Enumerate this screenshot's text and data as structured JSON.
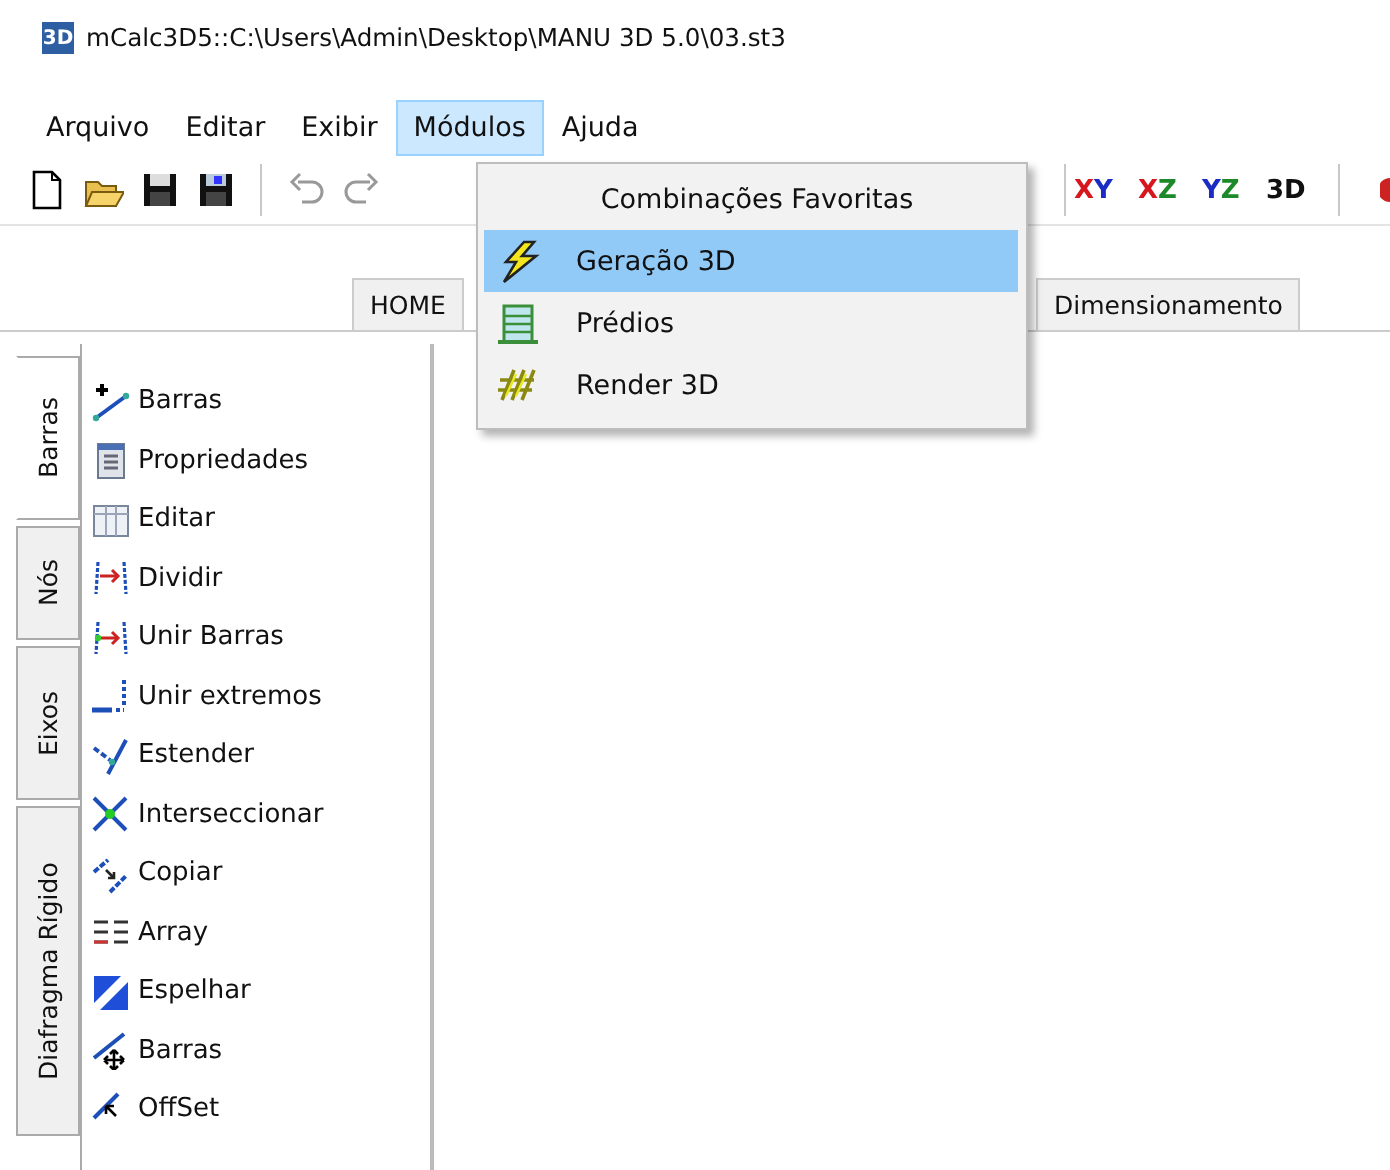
{
  "window": {
    "icon_text": "3D",
    "title": "mCalc3D5::C:\\Users\\Admin\\Desktop\\MANU 3D 5.0\\03.st3"
  },
  "menu_bar": [
    {
      "label": "Arquivo",
      "selected": false
    },
    {
      "label": "Editar",
      "selected": false
    },
    {
      "label": "Exibir",
      "selected": false
    },
    {
      "label": "Módulos",
      "selected": true
    },
    {
      "label": "Ajuda",
      "selected": false
    }
  ],
  "toolbar": {
    "view_buttons": [
      {
        "parts": [
          {
            "text": "X",
            "color": "#d8161e"
          },
          {
            "text": "Y",
            "color": "#1a2cc4"
          }
        ]
      },
      {
        "parts": [
          {
            "text": "X",
            "color": "#d8161e"
          },
          {
            "text": "Z",
            "color": "#1d8a2a"
          }
        ]
      },
      {
        "parts": [
          {
            "text": "Y",
            "color": "#1a2cc4"
          },
          {
            "text": "Z",
            "color": "#1d8a2a"
          }
        ]
      },
      {
        "parts": [
          {
            "text": "3D",
            "color": "#111111"
          }
        ]
      }
    ]
  },
  "tabs": [
    {
      "label": "HOME"
    },
    {
      "label": "Dimensionamento"
    }
  ],
  "side_tabs": [
    {
      "label": "Barras",
      "selected": true
    },
    {
      "label": "Nós",
      "selected": false
    },
    {
      "label": "Eixos",
      "selected": false
    },
    {
      "label": "Diafragma Rígido",
      "selected": false
    }
  ],
  "tools": [
    {
      "label": "Barras",
      "kind": "add-bar"
    },
    {
      "label": "Propriedades",
      "kind": "properties"
    },
    {
      "label": "Editar",
      "kind": "edit"
    },
    {
      "label": "Dividir",
      "kind": "divide"
    },
    {
      "label": "Unir Barras",
      "kind": "join"
    },
    {
      "label": "Unir extremos",
      "kind": "join-ends"
    },
    {
      "label": "Estender",
      "kind": "extend"
    },
    {
      "label": "Interseccionar",
      "kind": "intersect"
    },
    {
      "label": "Copiar",
      "kind": "copy"
    },
    {
      "label": "Array",
      "kind": "array"
    },
    {
      "label": "Espelhar",
      "kind": "mirror"
    },
    {
      "label": "Barras",
      "kind": "move"
    },
    {
      "label": "OffSet",
      "kind": "offset"
    }
  ],
  "dropdown": {
    "header": "Combinações Favoritas",
    "items": [
      {
        "label": "Geração 3D",
        "kind": "lightning",
        "selected": true
      },
      {
        "label": "Prédios",
        "kind": "building",
        "selected": false
      },
      {
        "label": "Render 3D",
        "kind": "render",
        "selected": false
      }
    ]
  }
}
